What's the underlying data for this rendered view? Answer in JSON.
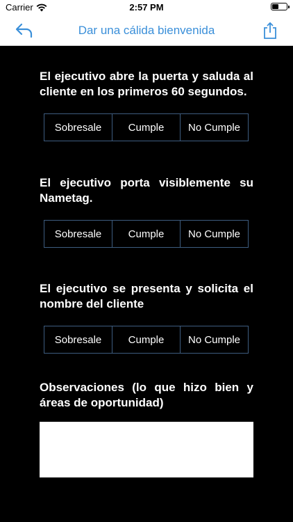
{
  "status": {
    "carrier": "Carrier",
    "time": "2:57 PM"
  },
  "nav": {
    "title": "Dar una cálida bienvenida",
    "back_icon": "back-arrow-icon",
    "share_icon": "share-icon",
    "accent": "#3a8fd9"
  },
  "questions": [
    {
      "text": "El ejecutivo abre la puerta y saluda al cliente en los primeros 60 segundos.",
      "options": [
        "Sobresale",
        "Cumple",
        "No Cumple"
      ]
    },
    {
      "text": "El ejecutivo porta visiblemente su Nametag.",
      "options": [
        "Sobresale",
        "Cumple",
        "No Cumple"
      ]
    },
    {
      "text": "El ejecutivo se presenta y solicita el nombre del cliente",
      "options": [
        "Sobresale",
        "Cumple",
        "No Cumple"
      ]
    }
  ],
  "observations": {
    "label": "Observaciones (lo que hizo bien y áreas de oportunidad)",
    "value": ""
  },
  "colors": {
    "background": "#000000",
    "segment_border": "#3e5d80"
  }
}
